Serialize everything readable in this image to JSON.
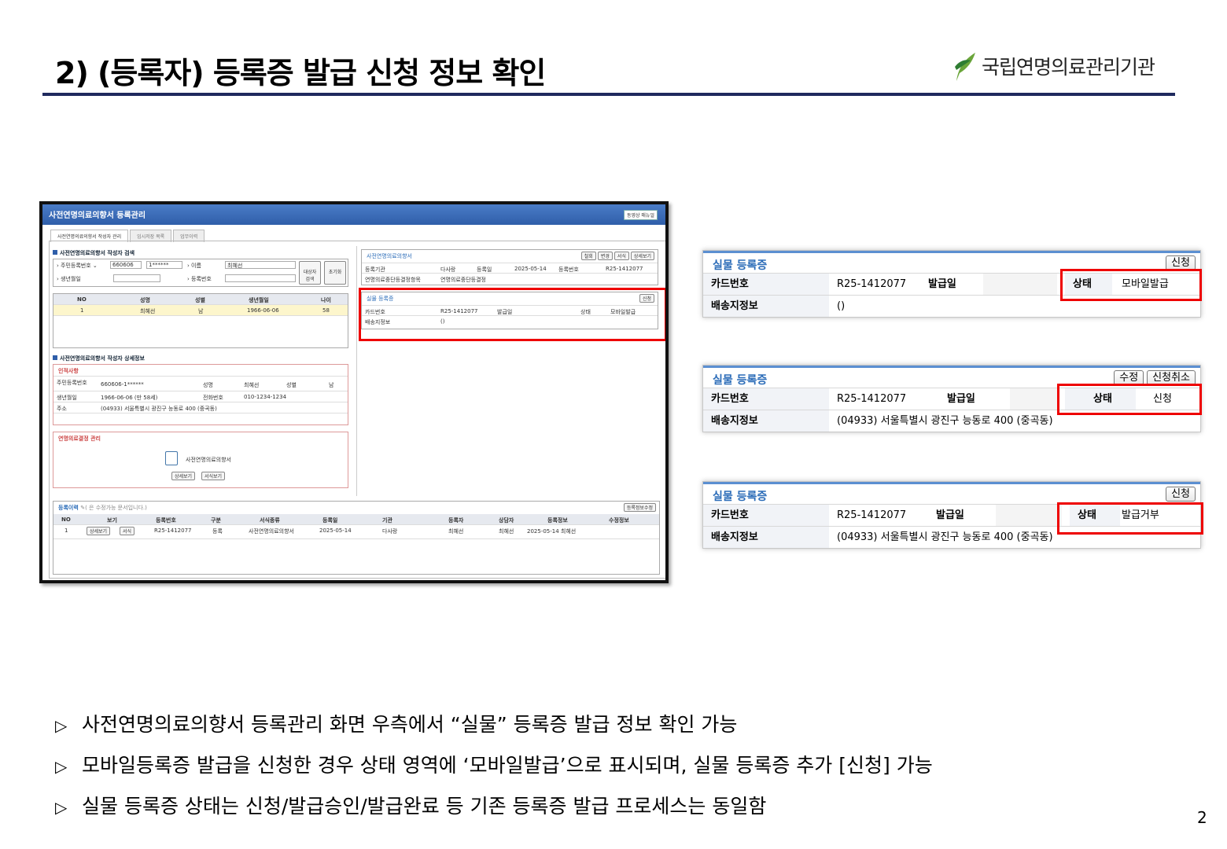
{
  "header": {
    "title": "2) (등록자) 등록증 발급 신청 정보 확인",
    "logo_text": "국립연명의료관리기관"
  },
  "page_number": "2",
  "bullets": [
    "사전연명의료의향서 등록관리 화면 우측에서 “실물” 등록증 발급 정보 확인 가능",
    "모바일등록증 발급을 신청한 경우 상태 영역에 ‘모바일발급’으로 표시되며, 실물 등록증 추가 [신청] 가능",
    "실물 등록증 상태는 신청/발급승인/발급완료 등 기존 등록증 발급 프로세스는 동일함"
  ],
  "screenshot": {
    "title": "사전연명의료의향서 등록관리",
    "manual_btn": "동영상 매뉴얼",
    "tabs": [
      "사전연명의료의향서 작성자 관리",
      "임시저장 목록",
      "업무이력"
    ],
    "search": {
      "section": "사전연명의료의향서 작성자 검색",
      "rrn_label": "주민등록번호",
      "rrn1": "660606",
      "rrn2": "1******",
      "name_label": "이름",
      "name_val": "최혜선",
      "birth_label": "생년월일",
      "regno_label": "등록번호",
      "search_btn": "대상자 검색",
      "reset_btn": "초기화"
    },
    "table": {
      "headers": [
        "NO",
        "성명",
        "성별",
        "생년월일",
        "나이"
      ],
      "row": [
        "1",
        "최혜선",
        "남",
        "1966-06-06",
        "58"
      ]
    },
    "detail": {
      "section": "사전연명의료의향서 작성자 상세정보",
      "personal": "인적사항",
      "rrn_label": "주민등록번호",
      "rrn": "660606-1******",
      "name_label": "성명",
      "name": "최혜선",
      "sex_label": "성별",
      "sex": "남",
      "birth_label": "생년월일",
      "birth": "1966-06-06 (만 58세)",
      "phone_label": "전화번호",
      "phone": "010-1234-1234",
      "addr_label": "주소",
      "addr": "(04933) 서울특별시 광진구 능동로 400 (중곡동)",
      "decision": "연명의료결정 관리",
      "doc": "사전연명의료의향서",
      "btn_view": "상세보기",
      "btn_form": "서식보기"
    },
    "right": {
      "section": "사전연명의료의향서",
      "btns": [
        "철회",
        "변경",
        "서식",
        "상세보기"
      ],
      "org_label": "등록기관",
      "org": "다사랑",
      "date_label": "등록일",
      "date": "2025-05-14",
      "no_label": "등록번호",
      "no": "R25-1412077",
      "stop_label": "연명의료중단등결정항목",
      "stop": "연명의료중단등결정"
    },
    "card": {
      "title": "실물 등록증",
      "btn": "신청",
      "card_label": "카드번호",
      "card": "R25-1412077",
      "issue_label": "발급일",
      "status_label": "상태",
      "status": "모바일발급",
      "ship_label": "배송지정보",
      "ship": "()"
    },
    "history": {
      "title": "등록이력",
      "note": "( 은 수정가능 문서입니다.)",
      "btn": "등록정보수정",
      "headers": [
        "NO",
        "보기",
        "등록번호",
        "구분",
        "서식종류",
        "등록일",
        "기관",
        "등록자",
        "상담자",
        "등록정보",
        "수정정보"
      ],
      "row": [
        "1",
        "상세보기",
        "서식",
        "R25-1412077",
        "등록",
        "사전연명의료의향서",
        "2025-05-14",
        "다사랑",
        "최혜선",
        "최혜선",
        "2025-05-14 최혜선"
      ]
    }
  },
  "panels": [
    {
      "title": "실물 등록증",
      "buttons": [
        "신청"
      ],
      "card_label": "카드번호",
      "card": "R25-1412077",
      "issue_label": "발급일",
      "status_label": "상태",
      "status": "모바일발급",
      "ship_label": "배송지정보",
      "ship": "()"
    },
    {
      "title": "실물 등록증",
      "buttons": [
        "수정",
        "신청취소"
      ],
      "card_label": "카드번호",
      "card": "R25-1412077",
      "issue_label": "발급일",
      "status_label": "상태",
      "status": "신청",
      "ship_label": "배송지정보",
      "ship": "(04933) 서울특별시 광진구 능동로 400 (중곡동)"
    },
    {
      "title": "실물 등록증",
      "buttons": [
        "신청"
      ],
      "card_label": "카드번호",
      "card": "R25-1412077",
      "issue_label": "발급일",
      "status_label": "상태",
      "status": "발급거부",
      "ship_label": "배송지정보",
      "ship": "(04933) 서울특별시 광진구 능동로 400 (중곡동)"
    }
  ]
}
